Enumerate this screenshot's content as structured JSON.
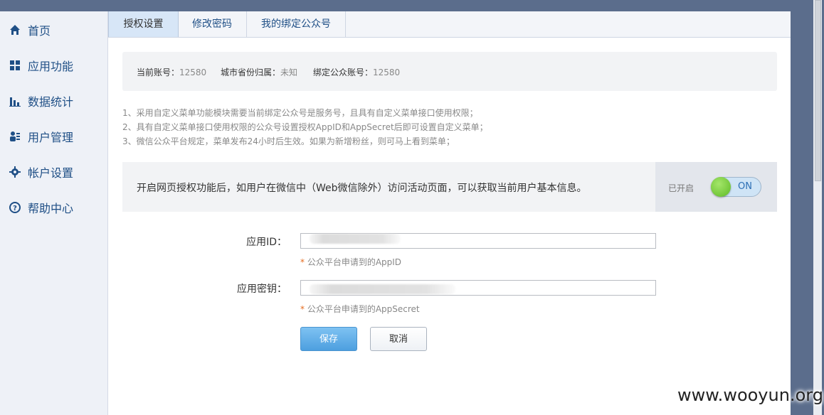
{
  "sidebar": {
    "items": [
      {
        "label": "首页",
        "icon": "home-icon"
      },
      {
        "label": "应用功能",
        "icon": "grid-icon"
      },
      {
        "label": "数据统计",
        "icon": "bar-chart-icon"
      },
      {
        "label": "用户管理",
        "icon": "users-icon"
      },
      {
        "label": "帐户设置",
        "icon": "gear-icon"
      },
      {
        "label": "帮助中心",
        "icon": "help-icon"
      }
    ]
  },
  "tabs": [
    {
      "label": "授权设置",
      "active": true
    },
    {
      "label": "修改密码",
      "active": false
    },
    {
      "label": "我的绑定公众号",
      "active": false
    }
  ],
  "account": {
    "current_label": "当前账号：",
    "current_value": "12580",
    "city_label": "城市省份归属：",
    "city_value": "未知",
    "bound_label": "绑定公众账号：",
    "bound_value": "12580"
  },
  "notes": [
    "1、采用自定义菜单功能模块需要当前绑定公众号是服务号，且具有自定义菜单接口使用权限；",
    "2、具有自定义菜单接口使用权限的公众号设置授权AppID和AppSecret后即可设置自定义菜单；",
    "3、微信公众平台规定，菜单发布24小时后生效。如果为新增粉丝，则可马上看到菜单；"
  ],
  "oauth": {
    "text": "开启网页授权功能后，如用户在微信中（Web微信除外）访问活动页面，可以获取当前用户基本信息。",
    "status_label": "已开启",
    "toggle_label": "ON",
    "toggle_on": true
  },
  "form": {
    "appid_label": "应用ID：",
    "appid_hint": "公众平台申请到的AppID",
    "secret_label": "应用密钥：",
    "secret_hint": "公众平台申请到的AppSecret",
    "required_mark": "*",
    "save_label": "保存",
    "cancel_label": "取消"
  },
  "watermark": "www.wooyun.org",
  "colors": {
    "accent": "#4d9fdf",
    "nav_text": "#1f4f86",
    "toggle_green": "#5fba25"
  }
}
